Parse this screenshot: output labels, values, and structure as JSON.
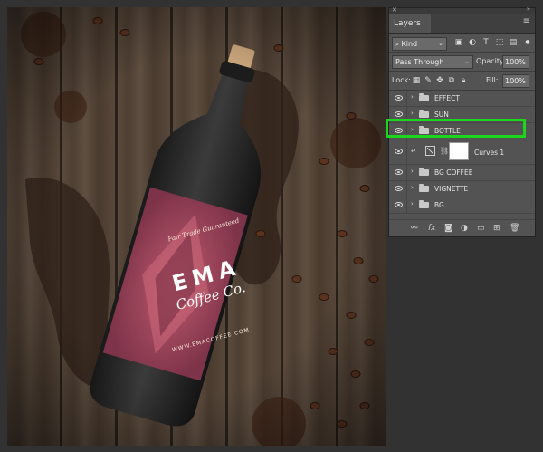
{
  "panel": {
    "title": "Layers",
    "filter_kind": "Kind",
    "blend_mode": "Pass Through",
    "opacity_label": "Opacity:",
    "opacity_value": "100%",
    "lock_label": "Lock:",
    "fill_label": "Fill:",
    "fill_value": "100%",
    "layers": [
      {
        "name": "EFFECT",
        "type": "group"
      },
      {
        "name": "SUN",
        "type": "group"
      },
      {
        "name": "BOTTLE",
        "type": "group",
        "highlighted": true
      },
      {
        "name": "Curves 1",
        "type": "adjustment"
      },
      {
        "name": "BG COFFEE",
        "type": "group"
      },
      {
        "name": "VIGNETTE",
        "type": "group"
      },
      {
        "name": "BG",
        "type": "group"
      }
    ],
    "highlight_color": "#1bd61b"
  },
  "artwork": {
    "tagline": "Fair Trade Guaranteed",
    "brand": "EMA",
    "subbrand": "Coffee Co.",
    "url": "WWW.EMACOFFEE.COM",
    "label_color": "#a04860"
  }
}
